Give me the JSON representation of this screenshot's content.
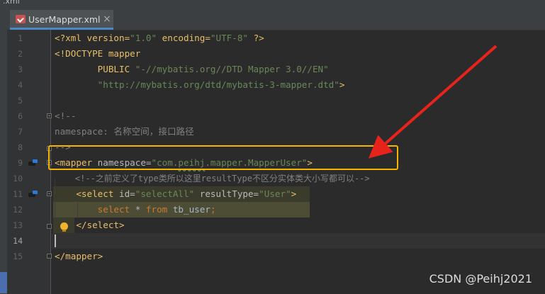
{
  "window": {
    "title_fragment": ".xml"
  },
  "tab": {
    "label": "UserMapper.xml",
    "close": "×",
    "icon": "xml-file-icon"
  },
  "lines": [
    {
      "n": "1"
    },
    {
      "n": "2"
    },
    {
      "n": "3"
    },
    {
      "n": "4"
    },
    {
      "n": "5"
    },
    {
      "n": "6"
    },
    {
      "n": "7"
    },
    {
      "n": "8"
    },
    {
      "n": "9"
    },
    {
      "n": "10"
    },
    {
      "n": "11"
    },
    {
      "n": "12"
    },
    {
      "n": "13"
    },
    {
      "n": "14"
    },
    {
      "n": "15"
    }
  ],
  "code": {
    "l1": {
      "a": "<?xml version=",
      "b": "\"1.0\"",
      "c": " encoding=",
      "d": "\"UTF-8\"",
      "e": " ?>"
    },
    "l2": {
      "a": "<!DOCTYPE",
      "b": " mapper"
    },
    "l3": {
      "a": "        PUBLIC ",
      "b": "\"-//mybatis.org//DTD Mapper 3.0//EN\""
    },
    "l4": {
      "a": "        \"http://mybatis.org/dtd/mybatis-3-mapper.dtd\"",
      "b": ">"
    },
    "l6": "<!--",
    "l7": "namespace: 名称空间，接口路径",
    "l8": "-->",
    "l9": {
      "a": "<mapper",
      "b": " namespace=",
      "c1": "\"com.",
      "c2": "peihj",
      "c3": ".mapper.MapperUser\"",
      "d": ">"
    },
    "l10": "    <!--之前定义了type类所以这里resultType不区分实体类大小写都可以-->",
    "l11": {
      "a": "    <select",
      "b": " id=",
      "c": "\"selectAll\"",
      "d": " resultType=",
      "e": "\"User\"",
      "f": ">"
    },
    "l12": {
      "a": "        ",
      "b": "select",
      "c": " * ",
      "d": "from",
      "e": " tb_user",
      "f": ";"
    },
    "l13": "    </select>",
    "l15": "</mapper>"
  },
  "annotation": {
    "box_color": "#f5b400",
    "arrow_color": "#e8231c"
  },
  "watermark": "CSDN @Peihj2021"
}
